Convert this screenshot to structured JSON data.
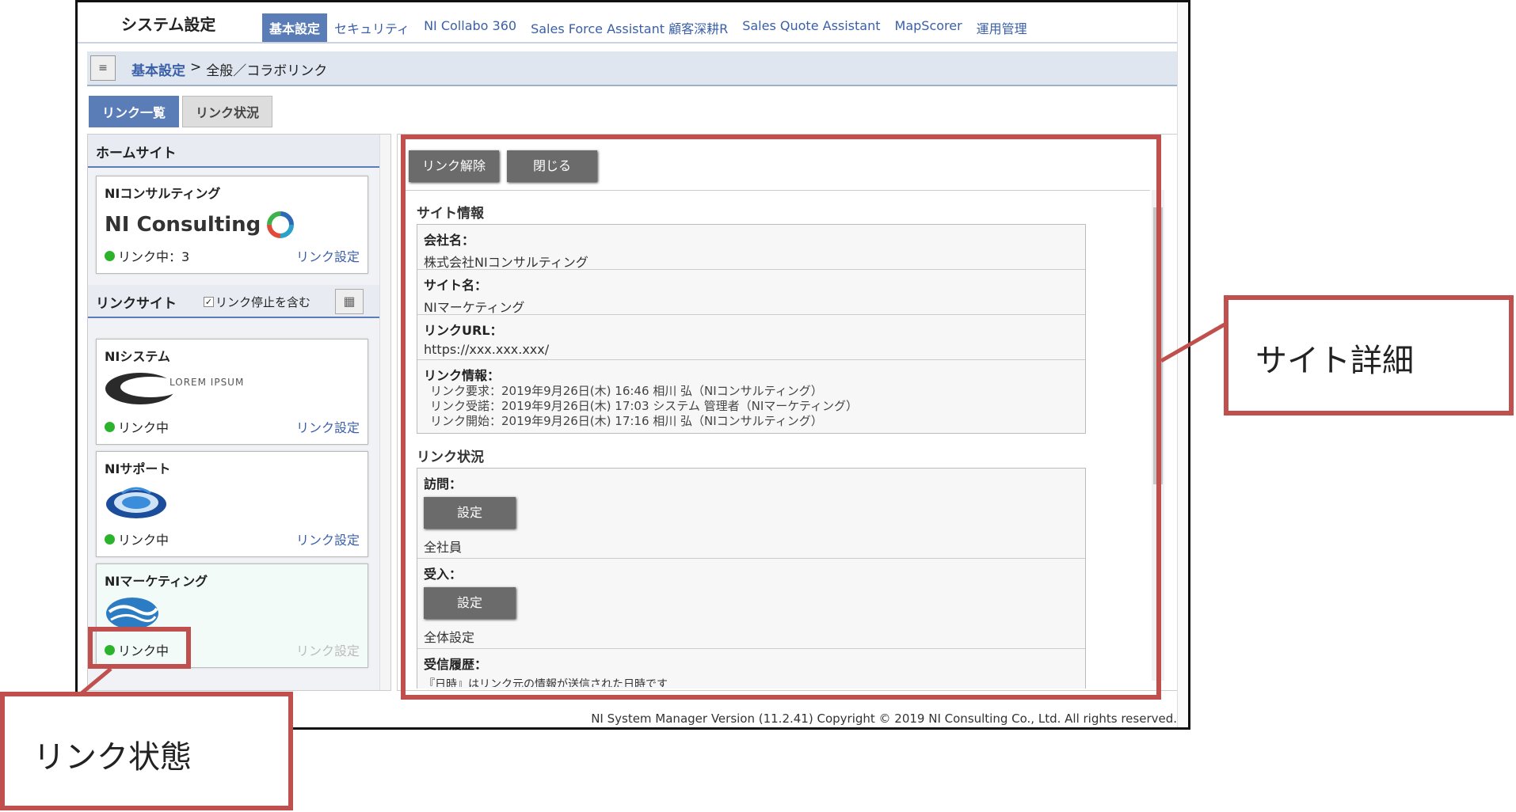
{
  "app": {
    "title": "システム設定"
  },
  "tabs": [
    "基本設定",
    "セキュリティ",
    "NI Collabo 360",
    "Sales Force Assistant 顧客深耕R",
    "Sales Quote Assistant",
    "MapScorer",
    "運用管理"
  ],
  "breadcrumb": {
    "menu_icon": "≡",
    "link": "基本設定",
    "sep": ">",
    "current": "全般／コラボリンク"
  },
  "subtabs": [
    "リンク一覧",
    "リンク状況"
  ],
  "left": {
    "home_header": "ホームサイト",
    "home_card": {
      "name": "NIコンサルティング",
      "logo_text": "NI Consulting",
      "status": "リンク中：3",
      "link": "リンク設定"
    },
    "link_header": "リンクサイト",
    "include_stopped": "リンク停止を含む",
    "cards": [
      {
        "name": "NIシステム",
        "logo_text": "LOREM IPSUM",
        "status": "リンク中",
        "link": "リンク設定"
      },
      {
        "name": "NIサポート",
        "status": "リンク中",
        "link": "リンク設定"
      },
      {
        "name": "NIマーケティング",
        "status": "リンク中",
        "link": "リンク設定"
      }
    ]
  },
  "actions": {
    "unlink": "リンク解除",
    "close": "閉じる"
  },
  "site_info": {
    "title": "サイト情報",
    "company_label": "会社名：",
    "company": "株式会社NIコンサルティング",
    "site_label": "サイト名：",
    "site": "NIマーケティング",
    "url_label": "リンクURL：",
    "url": "https://xxx.xxx.xxx/",
    "info_label": "リンク情報：",
    "info_lines": [
      "リンク要求：2019年9月26日(木) 16:46 相川 弘（NIコンサルティング）",
      "リンク受諾：2019年9月26日(木) 17:03 システム 管理者（NIマーケティング）",
      "リンク開始：2019年9月26日(木) 17:16 相川 弘（NIコンサルティング）"
    ]
  },
  "link_status": {
    "title": "リンク状況",
    "visit_label": "訪問：",
    "visit_btn": "設定",
    "visit_value": "全社員",
    "accept_label": "受入：",
    "accept_btn": "設定",
    "accept_value": "全体設定",
    "history_label": "受信履歴：",
    "history_value": "『日時』はリンク元の情報が送信された日時です"
  },
  "footer": "NI System Manager Version (11.2.41) Copyright © 2019 NI Consulting Co., Ltd. All rights reserved.",
  "callouts": {
    "site_detail": "サイト詳細",
    "link_state": "リンク状態"
  },
  "colors": {
    "accent": "#5a7db8",
    "highlight": "#c0504d",
    "status_green": "#2bb42b"
  }
}
